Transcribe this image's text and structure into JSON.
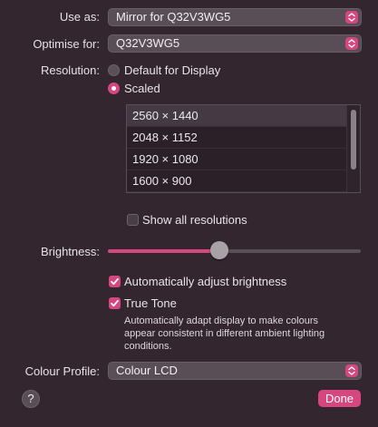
{
  "use_as": {
    "label": "Use as:",
    "value": "Mirror for Q32V3WG5"
  },
  "optimise_for": {
    "label": "Optimise for:",
    "value": "Q32V3WG5"
  },
  "resolution": {
    "label": "Resolution:",
    "options": [
      "Default for Display",
      "Scaled"
    ],
    "selected": "Scaled",
    "list": [
      "2560 × 1440",
      "2048 × 1152",
      "1920 × 1080",
      "1600 × 900"
    ],
    "selected_index": 0,
    "show_all_label": "Show all resolutions",
    "show_all_checked": false
  },
  "brightness": {
    "label": "Brightness:",
    "level": 0.44,
    "auto_adjust_label": "Automatically adjust brightness",
    "auto_adjust_checked": true
  },
  "true_tone": {
    "label": "True Tone",
    "checked": true,
    "description_lines": [
      "Automatically adapt display to make colours",
      "appear consistent in different ambient lighting",
      "conditions."
    ]
  },
  "colour_profile": {
    "label": "Colour Profile:",
    "value": "Colour LCD"
  },
  "help_label": "?",
  "done_label": "Done",
  "colors": {
    "accent": "#d6477f",
    "background": "#33262f"
  }
}
